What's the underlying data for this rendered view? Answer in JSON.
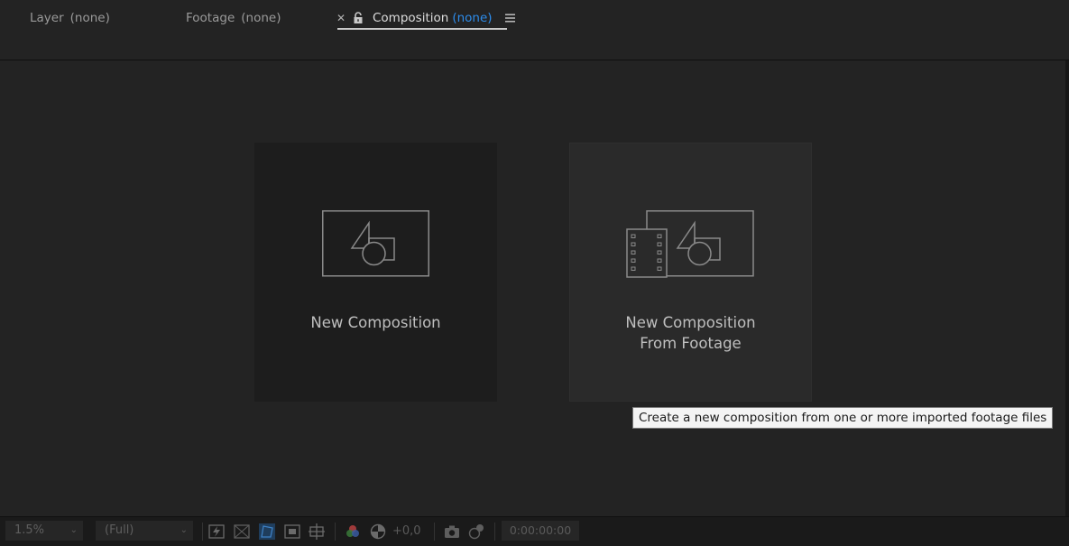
{
  "tabs": [
    {
      "name": "Layer",
      "value": "(none)"
    },
    {
      "name": "Footage",
      "value": "(none)"
    },
    {
      "name": "Composition",
      "value": "(none)"
    }
  ],
  "cards": {
    "new_composition": {
      "label": "New Composition"
    },
    "from_footage": {
      "line1": "New Composition",
      "line2": "From Footage"
    }
  },
  "tooltip": "Create a new composition from one or more imported footage files",
  "bottom_toolbar": {
    "zoom": "1.5%",
    "resolution": "(Full)",
    "exposure": "+0,0",
    "timecode": "0:00:00:00"
  },
  "icons": {
    "close": "close-icon",
    "lock": "lock-icon",
    "menu": "hamburger-menu-icon"
  },
  "colors": {
    "accent_blue": "#2d8ceb",
    "background": "#232323",
    "card_dark": "#1d1d1d",
    "card_hover": "#2a2a2a"
  }
}
